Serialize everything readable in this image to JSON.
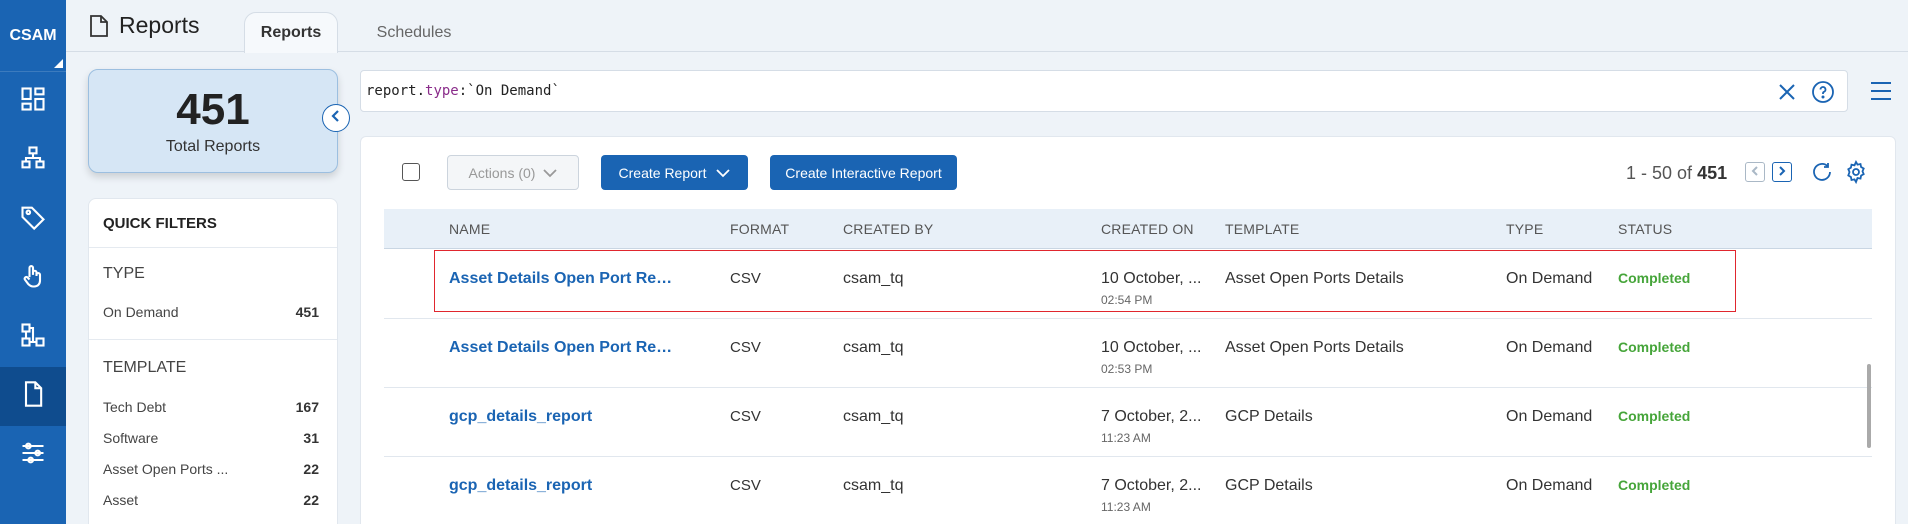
{
  "app": {
    "logo": "CSAM"
  },
  "header": {
    "title": "Reports",
    "tabs": [
      {
        "label": "Reports",
        "active": true
      },
      {
        "label": "Schedules",
        "active": false
      }
    ]
  },
  "nav": [
    {
      "icon": "dashboard-icon",
      "active": false
    },
    {
      "icon": "inventory-icon",
      "active": false
    },
    {
      "icon": "tag-icon",
      "active": false
    },
    {
      "icon": "touch-icon",
      "active": false
    },
    {
      "icon": "network-icon",
      "active": true
    },
    {
      "icon": "document-icon",
      "active": true
    },
    {
      "icon": "sliders-icon",
      "active": false
    }
  ],
  "summary": {
    "total": "451",
    "label": "Total Reports"
  },
  "quick_filters": {
    "title": "QUICK FILTERS",
    "sections": [
      {
        "title": "TYPE",
        "items": [
          {
            "label": "On Demand",
            "count": "451"
          }
        ]
      },
      {
        "title": "TEMPLATE",
        "items": [
          {
            "label": "Tech Debt",
            "count": "167"
          },
          {
            "label": "Software",
            "count": "31"
          },
          {
            "label": "Asset Open Ports ...",
            "count": "22"
          },
          {
            "label": "Asset",
            "count": "22"
          }
        ]
      }
    ]
  },
  "search": {
    "query_prefix": "report.",
    "query_keyword": "type",
    "query_suffix": ":`On Demand`"
  },
  "toolbar": {
    "actions_label": "Actions (0)",
    "create_report_label": "Create Report",
    "create_interactive_label": "Create Interactive Report",
    "pager_range": "1 - 50 of",
    "pager_total": "451"
  },
  "table": {
    "columns": [
      "NAME",
      "FORMAT",
      "CREATED BY",
      "CREATED ON",
      "TEMPLATE",
      "TYPE",
      "STATUS"
    ],
    "rows": [
      {
        "name": "Asset Details Open Port Rep...",
        "format": "CSV",
        "created_by": "csam_tq",
        "created_on": "10 October, ...",
        "time": "02:54 PM",
        "template": "Asset Open Ports Details",
        "type": "On Demand",
        "status": "Completed",
        "highlighted": true
      },
      {
        "name": "Asset Details Open Port Rep...",
        "format": "CSV",
        "created_by": "csam_tq",
        "created_on": "10 October, ...",
        "time": "02:53 PM",
        "template": "Asset Open Ports Details",
        "type": "On Demand",
        "status": "Completed",
        "highlighted": false
      },
      {
        "name": "gcp_details_report",
        "format": "CSV",
        "created_by": "csam_tq",
        "created_on": "7 October, 2...",
        "time": "11:23 AM",
        "template": "GCP Details",
        "type": "On Demand",
        "status": "Completed",
        "highlighted": false
      },
      {
        "name": "gcp_details_report",
        "format": "CSV",
        "created_by": "csam_tq",
        "created_on": "7 October, 2...",
        "time": "11:23 AM",
        "template": "GCP Details",
        "type": "On Demand",
        "status": "Completed",
        "highlighted": false
      }
    ]
  },
  "colors": {
    "primary": "#1a64b3",
    "success": "#46a53a",
    "highlight": "#e0262e"
  }
}
